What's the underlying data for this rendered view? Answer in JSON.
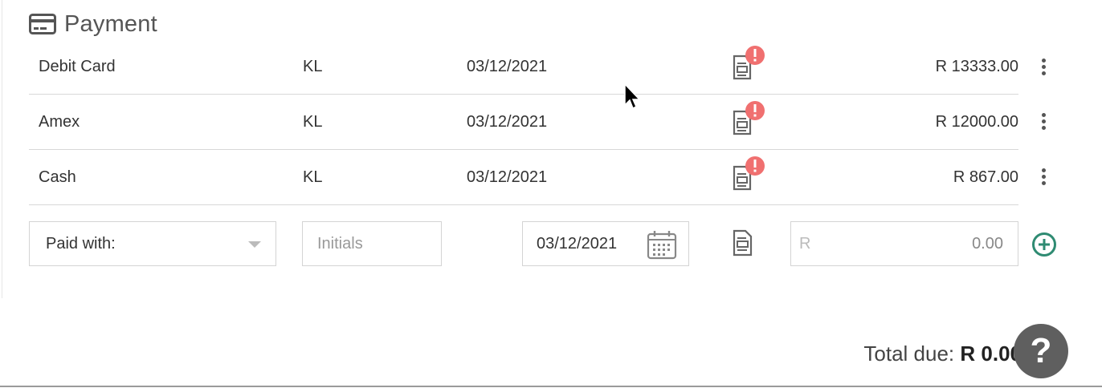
{
  "section": {
    "title": "Payment",
    "icon": "credit-card-icon"
  },
  "payments": [
    {
      "method": "Debit Card",
      "initials": "KL",
      "date": "03/12/2021",
      "amount": "R 13333.00",
      "receipt_icon": "receipt-alert-icon"
    },
    {
      "method": "Amex",
      "initials": "KL",
      "date": "03/12/2021",
      "amount": "R 12000.00",
      "receipt_icon": "receipt-alert-icon"
    },
    {
      "method": "Cash",
      "initials": "KL",
      "date": "03/12/2021",
      "amount": "R 867.00",
      "receipt_icon": "receipt-alert-icon"
    }
  ],
  "new_payment": {
    "paid_with_label": "Paid with:",
    "initials_placeholder": "Initials",
    "date_value": "03/12/2021",
    "currency_symbol": "R",
    "amount_value": "0.00"
  },
  "total": {
    "label": "Total due: ",
    "amount": "R 0.00"
  },
  "help": {
    "label": "?"
  },
  "colors": {
    "alert": "#f07070",
    "add": "#2e8b72",
    "icon": "#666666",
    "help_bg": "#5f5f5f"
  }
}
